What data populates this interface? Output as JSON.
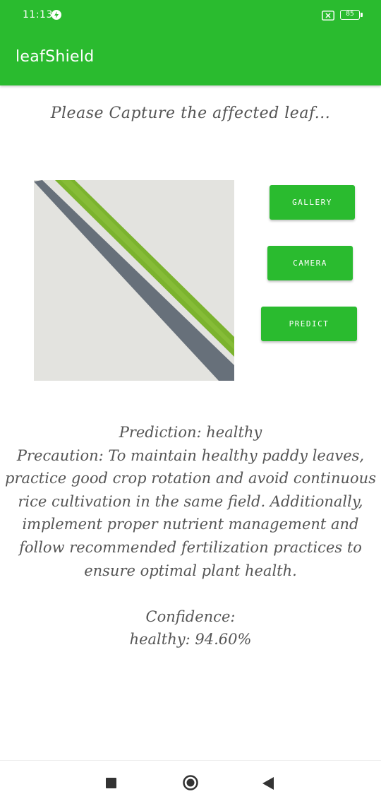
{
  "status_bar": {
    "time": "11:13",
    "battery": "85",
    "icons": [
      "bolt-icon",
      "x-icon",
      "battery-icon"
    ]
  },
  "app_bar": {
    "title": "leafShield"
  },
  "main": {
    "instruction": "Please Capture the affected leaf...",
    "image": {
      "icon": "leaf-photo"
    },
    "buttons": {
      "gallery": "GALLERY",
      "camera": "CAMERA",
      "predict": "PREDICT"
    },
    "result": {
      "prediction": "Prediction: healthy",
      "precaution": "Precaution: To maintain healthy paddy leaves, practice good crop rotation and avoid continuous rice cultivation in the same field. Additionally, implement proper nutrient management and follow recommended fertilization practices to ensure optimal plant health.",
      "confidence_label": "Confidence:",
      "confidence_value": "healthy: 94.60%"
    }
  },
  "nav_bar": {
    "icons": [
      "recent-apps-icon",
      "home-icon",
      "back-icon"
    ]
  },
  "colors": {
    "primary": "#2abb2f",
    "text": "#555555",
    "leaf": "#7bb32e"
  }
}
